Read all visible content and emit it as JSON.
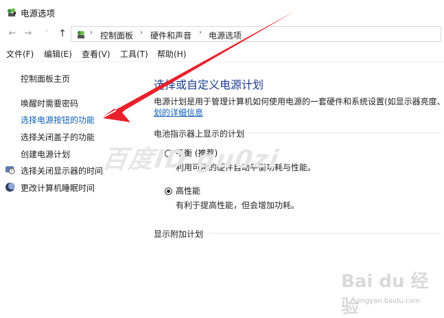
{
  "window": {
    "title": "电源选项"
  },
  "nav": {
    "back": "←",
    "forward": "→",
    "recent": "˅",
    "up": "↑",
    "breadcrumb": [
      "控制面板",
      "硬件和声音",
      "电源选项"
    ],
    "separator": "›"
  },
  "menu": [
    "文件(F)",
    "编辑(E)",
    "查看(V)",
    "工具(T)",
    "帮助(H)"
  ],
  "sidebar": {
    "home": "控制面板主页",
    "links": [
      "唤醒时需要密码",
      "选择电源按钮的功能",
      "选择关闭盖子的功能",
      "创建电源计划",
      "选择关闭显示器的时间",
      "更改计算机睡眠时间"
    ]
  },
  "main": {
    "title": "选择或自定义电源计划",
    "desc": "电源计划是用于管理计算机如何使用电源的一套硬件和系统设置(如显示器亮度、",
    "desc_link": "划的详细信息",
    "battery_group": "电池指示器上显示的计划",
    "plans": [
      {
        "name": "平衡 (推荐)",
        "desc": "利用可用的硬件自动平衡功耗与性能。",
        "selected": false
      },
      {
        "name": "高性能",
        "desc": "有利于提高性能，但会增加功耗。",
        "selected": true
      }
    ],
    "extra_group": "显示附加计划"
  },
  "watermark": {
    "text": "百度ID gu0zi",
    "brand": "Bai du 经验",
    "url": "jingyan.baidu.com"
  },
  "colors": {
    "link": "#0f5fb8",
    "title": "#1c3b8c",
    "arrow": "#e8202a"
  },
  "icons": {
    "app": "power-options-icon",
    "address": "control-panel-icon",
    "display": "display-clock-icon",
    "sleep": "moon-icon"
  }
}
